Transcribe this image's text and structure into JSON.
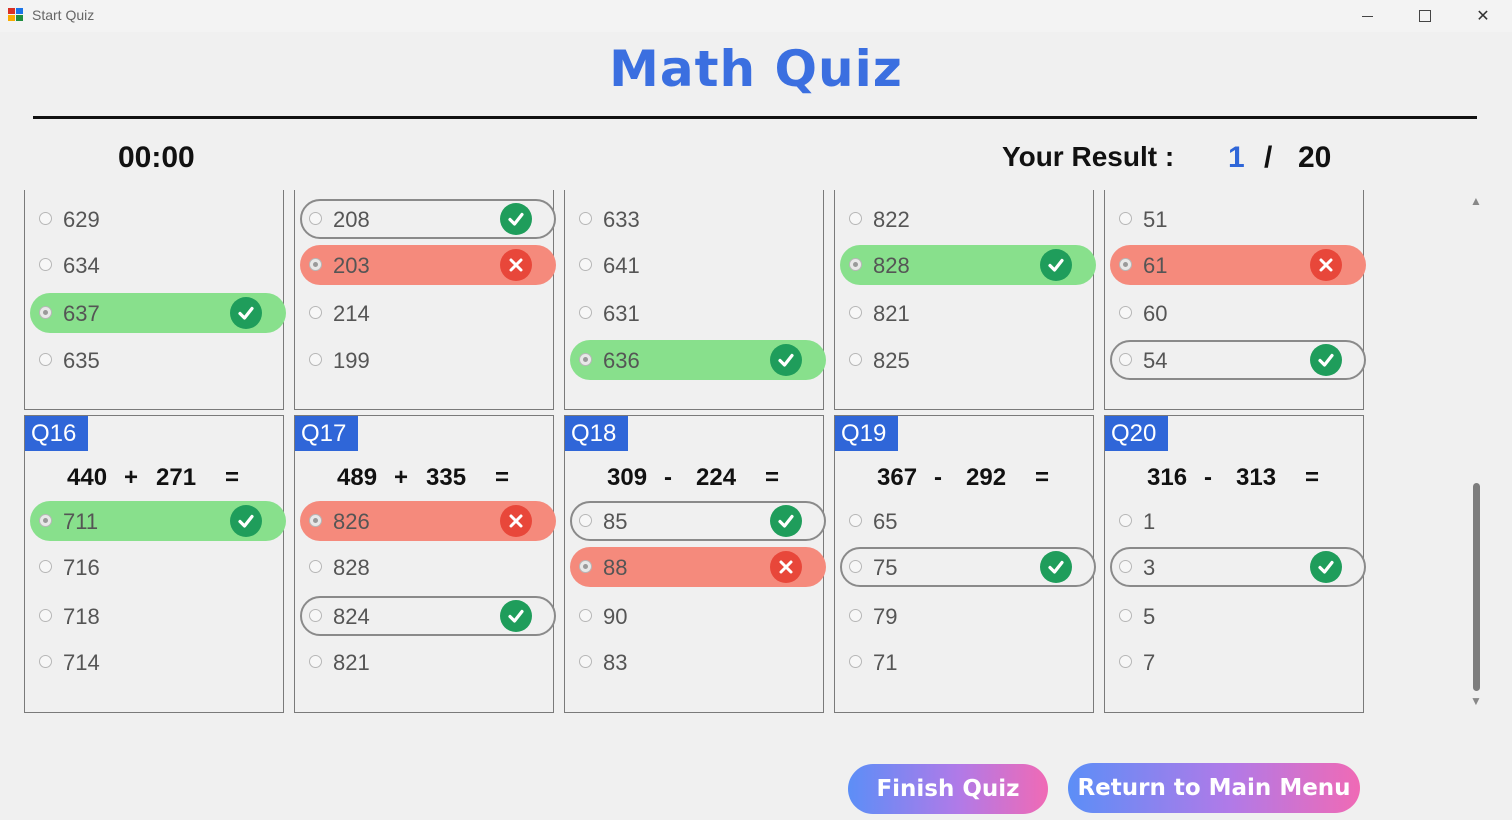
{
  "window": {
    "title": "Start Quiz"
  },
  "header": {
    "title": "Math Quiz",
    "timer": "00:00",
    "result_label": "Your Result :",
    "score": "1",
    "slash": "/",
    "total": "20"
  },
  "colors": {
    "accent": "#2f66d8",
    "correct": "#88e08c",
    "wrong": "#f58a7c",
    "check": "#1f9d5b",
    "cross": "#e8473a"
  },
  "top_cards": [
    {
      "options": [
        {
          "value": "629",
          "status": "none"
        },
        {
          "value": "634",
          "status": "none"
        },
        {
          "value": "637",
          "status": "correct-picked"
        },
        {
          "value": "635",
          "status": "none"
        }
      ]
    },
    {
      "options": [
        {
          "value": "208",
          "status": "correct-missed"
        },
        {
          "value": "203",
          "status": "wrong"
        },
        {
          "value": "214",
          "status": "none"
        },
        {
          "value": "199",
          "status": "none"
        }
      ]
    },
    {
      "options": [
        {
          "value": "633",
          "status": "none"
        },
        {
          "value": "641",
          "status": "none"
        },
        {
          "value": "631",
          "status": "none"
        },
        {
          "value": "636",
          "status": "correct-picked"
        }
      ]
    },
    {
      "options": [
        {
          "value": "822",
          "status": "none"
        },
        {
          "value": "828",
          "status": "correct-picked"
        },
        {
          "value": "821",
          "status": "none"
        },
        {
          "value": "825",
          "status": "none"
        }
      ]
    },
    {
      "options": [
        {
          "value": "51",
          "status": "none"
        },
        {
          "value": "61",
          "status": "wrong"
        },
        {
          "value": "60",
          "status": "none"
        },
        {
          "value": "54",
          "status": "correct-missed"
        }
      ]
    }
  ],
  "bottom_cards": [
    {
      "label": "Q16",
      "a": "440",
      "op": "+",
      "b": "271",
      "eq": "=",
      "options": [
        {
          "value": "711",
          "status": "correct-picked"
        },
        {
          "value": "716",
          "status": "none"
        },
        {
          "value": "718",
          "status": "none"
        },
        {
          "value": "714",
          "status": "none"
        }
      ]
    },
    {
      "label": "Q17",
      "a": "489",
      "op": "+",
      "b": "335",
      "eq": "=",
      "options": [
        {
          "value": "826",
          "status": "wrong"
        },
        {
          "value": "828",
          "status": "none"
        },
        {
          "value": "824",
          "status": "correct-missed"
        },
        {
          "value": "821",
          "status": "none"
        }
      ]
    },
    {
      "label": "Q18",
      "a": "309",
      "op": "-",
      "b": "224",
      "eq": "=",
      "options": [
        {
          "value": "85",
          "status": "correct-missed"
        },
        {
          "value": "88",
          "status": "wrong"
        },
        {
          "value": "90",
          "status": "none"
        },
        {
          "value": "83",
          "status": "none"
        }
      ]
    },
    {
      "label": "Q19",
      "a": "367",
      "op": "-",
      "b": "292",
      "eq": "=",
      "options": [
        {
          "value": "65",
          "status": "none"
        },
        {
          "value": "75",
          "status": "correct-missed"
        },
        {
          "value": "79",
          "status": "none"
        },
        {
          "value": "71",
          "status": "none"
        }
      ]
    },
    {
      "label": "Q20",
      "a": "316",
      "op": "-",
      "b": "313",
      "eq": "=",
      "options": [
        {
          "value": "1",
          "status": "none"
        },
        {
          "value": "3",
          "status": "correct-missed"
        },
        {
          "value": "5",
          "status": "none"
        },
        {
          "value": "7",
          "status": "none"
        }
      ]
    }
  ],
  "buttons": {
    "finish": "Finish Quiz",
    "return": "Return to Main Menu"
  }
}
